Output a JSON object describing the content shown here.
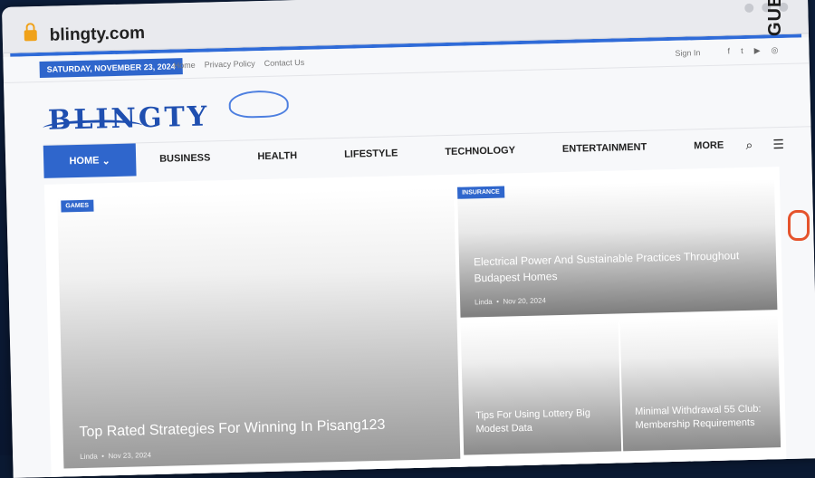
{
  "browser": {
    "url": "blingty.com"
  },
  "topbar": {
    "date": "SATURDAY, NOVEMBER 23, 2024",
    "links": [
      "Home",
      "Privacy Policy",
      "Contact Us"
    ],
    "signin": "Sign In"
  },
  "logo": {
    "text": "BLINGTY"
  },
  "nav": {
    "home": "HOME",
    "items": [
      "BUSINESS",
      "HEALTH",
      "LIFESTYLE",
      "TECHNOLOGY",
      "ENTERTAINMENT",
      "MORE"
    ]
  },
  "posts": {
    "main": {
      "tag": "GAMES",
      "title": "Top Rated Strategies For Winning In Pisang123",
      "author": "Linda",
      "date": "Nov 23, 2024"
    },
    "right_top": {
      "tag": "INSURANCE",
      "title": "Electrical Power And Sustainable Practices Throughout Budapest Homes",
      "author": "Linda",
      "date": "Nov 20, 2024"
    },
    "small_1": {
      "title": "Tips For Using Lottery Big Modest Data"
    },
    "small_2": {
      "title": "Minimal Withdrawal 55 Club: Membership Requirements"
    }
  },
  "watermark": {
    "text": "GUESTPOSTLINKS"
  }
}
